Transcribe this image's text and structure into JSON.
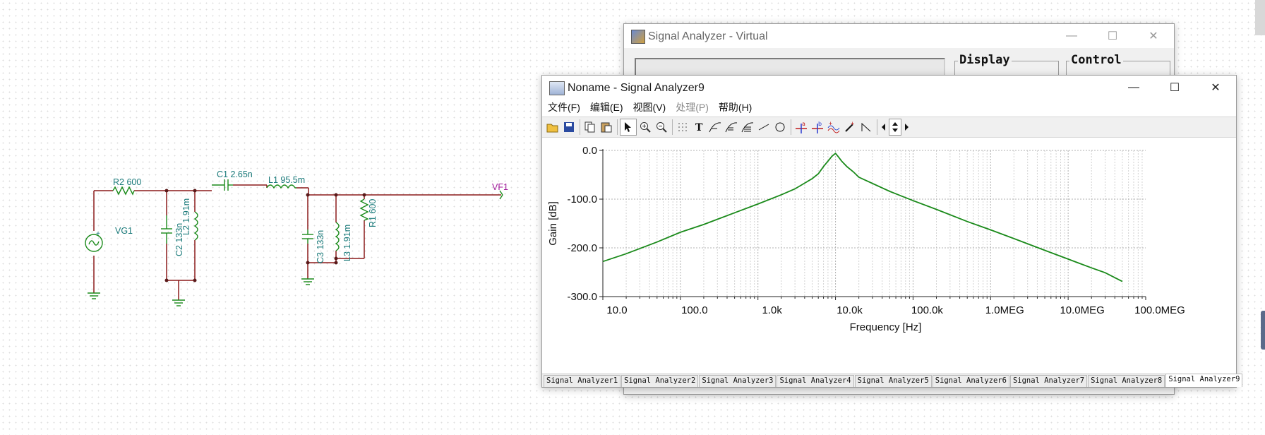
{
  "schematic": {
    "labels": {
      "r2": "R2 600",
      "c1": "C1 2.65n",
      "l1": "L1 95.5m",
      "vf1": "VF1",
      "vg1": "VG1",
      "c2": "C2 133n",
      "l2": "L2 1.91m",
      "c3": "C3 133n",
      "l3": "L3 1.91m",
      "r1": "R1 600",
      "plus": "+"
    }
  },
  "back_window": {
    "title": "Signal Analyzer - Virtual",
    "display_label": "Display",
    "control_label": "Control",
    "minimize": "—",
    "maximize": "☐",
    "close": "✕"
  },
  "front_window": {
    "title": "Noname - Signal Analyzer9",
    "minimize": "—",
    "maximize": "☐",
    "close": "✕",
    "menu": [
      "文件(F)",
      "编辑(E)",
      "视图(V)",
      "处理(P)",
      "帮助(H)"
    ],
    "menu_disabled": [
      false,
      false,
      false,
      true,
      false
    ],
    "toolbar_icons": [
      "open-icon",
      "save-icon",
      "copy-icon",
      "paste-icon",
      "pointer-icon",
      "zoom-in-icon",
      "zoom-out-icon",
      "grid-icon",
      "text-tool-icon",
      "curve-tool-1-icon",
      "curve-tool-2-icon",
      "curve-tool-3-icon",
      "line-tool-icon",
      "circle-tool-icon",
      "cursor-a-icon",
      "cursor-b-icon",
      "wave-marker-icon",
      "probe-icon",
      "step-icon",
      "scroll-left-icon",
      "scroll-updown-icon",
      "scroll-right-icon"
    ],
    "tabs": [
      "Signal Analyzer1",
      "Signal Analyzer2",
      "Signal Analyzer3",
      "Signal Analyzer4",
      "Signal Analyzer5",
      "Signal Analyzer6",
      "Signal Analyzer7",
      "Signal Analyzer8",
      "Signal Analyzer9"
    ],
    "active_tab": 8
  },
  "chart_data": {
    "type": "line",
    "title": "",
    "xlabel": "Frequency [Hz]",
    "ylabel": "Gain [dB]",
    "x_scale": "log",
    "xlim": [
      10,
      100000000
    ],
    "ylim": [
      -300,
      0
    ],
    "x_tick_labels": [
      "10.0",
      "100.0",
      "1.0k",
      "10.0k",
      "100.0k",
      "1.0MEG",
      "10.0MEG",
      "100.0MEG"
    ],
    "y_tick_labels": [
      "0.0",
      "-100.0",
      "-200.0",
      "-300.0"
    ],
    "y_ticks": [
      0,
      -100,
      -200,
      -300
    ],
    "grid": true,
    "line_color": "#1a8a1a",
    "series": [
      {
        "x": [
          10,
          20,
          50,
          100,
          200,
          500,
          1000,
          2000,
          3000,
          5000,
          6000,
          7000,
          8000,
          9000,
          10000,
          11000,
          12000,
          14000,
          17000,
          20000,
          50000,
          100000,
          200000,
          500000,
          1000000,
          2000000,
          5000000,
          10000000,
          20000000,
          30000000,
          50000000
        ],
        "y": [
          -228,
          -212,
          -188,
          -168,
          -152,
          -128,
          -110,
          -91,
          -79,
          -58,
          -48,
          -33,
          -22,
          -12,
          -6,
          -14,
          -22,
          -33,
          -44,
          -55,
          -84,
          -103,
          -121,
          -146,
          -163,
          -181,
          -205,
          -223,
          -241,
          -251,
          -269
        ]
      }
    ]
  }
}
